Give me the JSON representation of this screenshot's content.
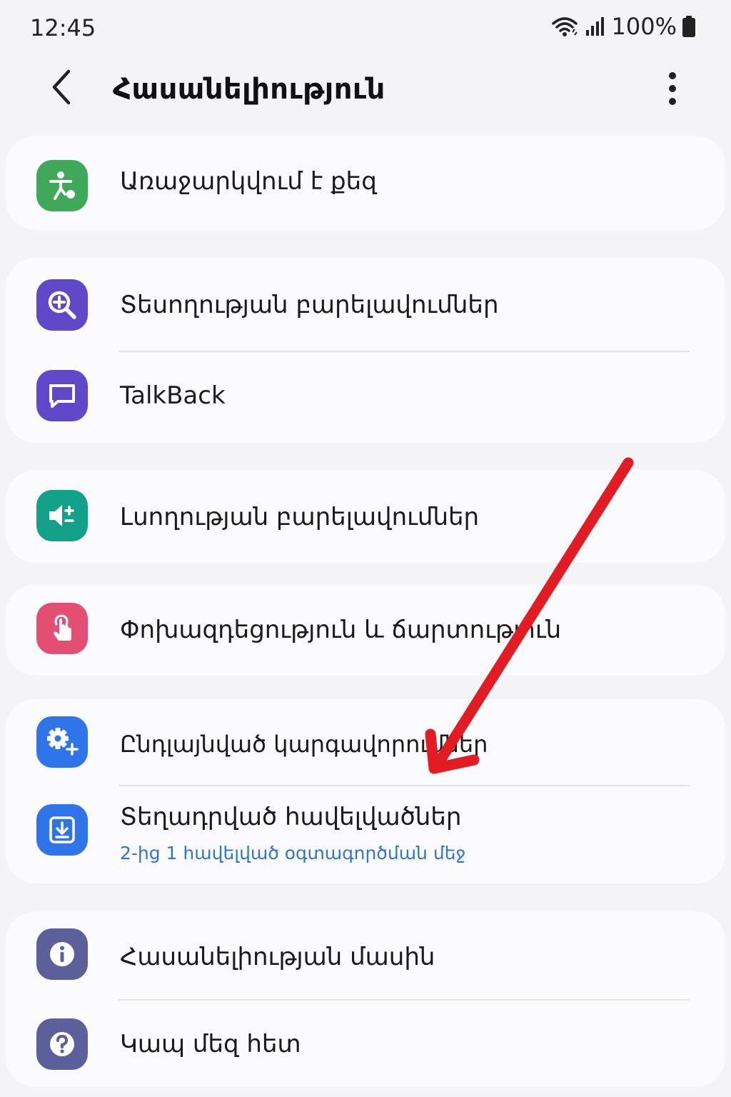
{
  "status_bar": {
    "time": "12:45",
    "battery": "100%"
  },
  "header": {
    "title": "Հասանելիություն"
  },
  "groups": [
    {
      "items": [
        {
          "label": "Առաջարկվում է քեզ",
          "icon": "accessibility-person-icon",
          "icon_color": "#3fa85a"
        }
      ]
    },
    {
      "items": [
        {
          "label": "Տեսողության բարելավումներ",
          "icon": "zoom-in-icon",
          "icon_color": "#6049c9"
        },
        {
          "label": "TalkBack",
          "icon": "chat-bubble-icon",
          "icon_color": "#6049c9"
        }
      ]
    },
    {
      "items": [
        {
          "label": "Լսողության բարելավումներ",
          "icon": "volume-plus-minus-icon",
          "icon_color": "#14a18a"
        }
      ]
    },
    {
      "items": [
        {
          "label": "Փոխազդեցություն և ճարտություն",
          "icon": "touch-hand-icon",
          "icon_color": "#e24f73"
        }
      ]
    },
    {
      "items": [
        {
          "label": "Ընդլայնված կարգավորումներ",
          "icon": "gear-plus-icon",
          "icon_color": "#2f74e8"
        },
        {
          "label": "Տեղադրված հավելվածներ",
          "sublabel": "2-ից 1 հավելված օգտագործման մեջ",
          "icon": "download-icon",
          "icon_color": "#2f74e8"
        }
      ]
    },
    {
      "items": [
        {
          "label": "Հասանելիության մասին",
          "icon": "info-icon",
          "icon_color": "#5b5f9a"
        },
        {
          "label": "Կապ մեզ հետ",
          "icon": "help-question-icon",
          "icon_color": "#5b5f9a"
        }
      ]
    }
  ],
  "colors": {
    "background": "#f4f4f8",
    "card": "#fbfbfd",
    "sublabel": "#2f74d6",
    "annotation_arrow": "#e31b23"
  }
}
